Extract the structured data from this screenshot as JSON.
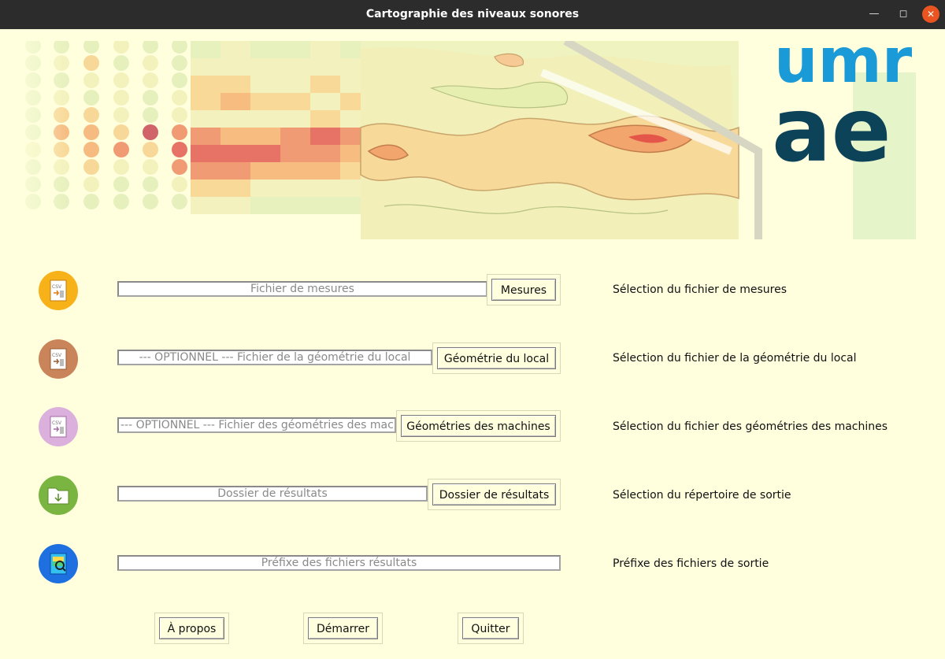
{
  "window": {
    "title": "Cartographie des niveaux sonores"
  },
  "rows": [
    {
      "placeholder": "Fichier de mesures",
      "button": "Mesures",
      "description": "Sélection du fichier de mesures",
      "icon": "csv-measures-icon",
      "color": "#f7b21a"
    },
    {
      "placeholder": "--- OPTIONNEL --- Fichier de la géométrie du local",
      "button": "Géométrie du local",
      "description": "Sélection du fichier de la géométrie du local",
      "icon": "csv-room-geometry-icon",
      "color": "#c9845a"
    },
    {
      "placeholder": "--- OPTIONNEL --- Fichier des géométries des machines",
      "button": "Géométries des machines",
      "description": "Sélection du fichier des géométries des machines",
      "icon": "csv-machine-geometry-icon",
      "color": "#d9a8d9"
    },
    {
      "placeholder": "Dossier de résultats",
      "button": "Dossier de résultats",
      "description": "Sélection du répertoire de sortie",
      "icon": "folder-download-icon",
      "color": "#7ab542"
    },
    {
      "placeholder": "Préfixe des fichiers résultats",
      "button": "",
      "description": "Préfixe des fichiers de sortie",
      "icon": "result-file-prefix-icon",
      "color": "#1e6fe0"
    }
  ],
  "footer": {
    "about": "À propos",
    "start": "Démarrer",
    "quit": "Quitter"
  },
  "banner": {
    "logo_top": "umr",
    "logo_bottom": "ae"
  },
  "colors": {
    "logo_light": "#1a9ad6",
    "logo_dark": "#0c4358",
    "background": "#ffffde",
    "close_button": "#e95420"
  }
}
